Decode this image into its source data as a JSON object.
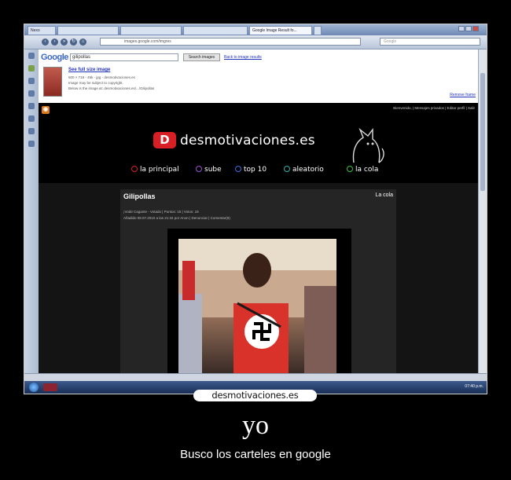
{
  "browser": {
    "tabs": [
      {
        "label": "Nexo"
      },
      {
        "label": ""
      },
      {
        "label": ""
      },
      {
        "label": ""
      },
      {
        "label": "Google Image Result fo..."
      }
    ],
    "url": "images.google.com/imgres",
    "search_placeholder": "Google"
  },
  "google": {
    "logo": "Google",
    "query": "gilipollas",
    "search_button": "Search images",
    "back_link": "Back to image results",
    "full_size_link": "See full size image",
    "meta_lines": [
      "500 × 718 - 45k - jpg - desmotivaciones.es",
      "Image may be subject to copyright.",
      "Below is the image at: desmotivaciones.es/.../Gilipollas"
    ],
    "remove_frame": "Remove frame"
  },
  "site": {
    "rss_label": "rss",
    "welcome": "Bienvenido, | Mensajes privados | Editar perfil | Salir",
    "logo_mark": "D",
    "logo_text": "desmotivaciones.es",
    "menu": [
      {
        "label": "la principal",
        "color": "#d91f26"
      },
      {
        "label": "sube",
        "color": "#9b4fd1"
      },
      {
        "label": "top 10",
        "color": "#3d6fe0"
      },
      {
        "label": "aleatorio",
        "color": "#2fb0a8"
      },
      {
        "label": "la cola",
        "color": "#3fbf3f"
      }
    ],
    "post": {
      "title": "Gilipollas",
      "queue_label": "La cola",
      "meta_1": "¡Votá! Cagante - Votado | Puntos: 15 | Votos: 19",
      "meta_2": "Añadido 08.07.2010 a las 21:34 por Anon | Denunciar | Comentar(8)"
    }
  },
  "taskbar": {
    "clock": "07:40 p.m."
  },
  "poster": {
    "brand": "desmotivaciones.es",
    "title": "yo",
    "subtitle": "Busco los carteles en google"
  }
}
